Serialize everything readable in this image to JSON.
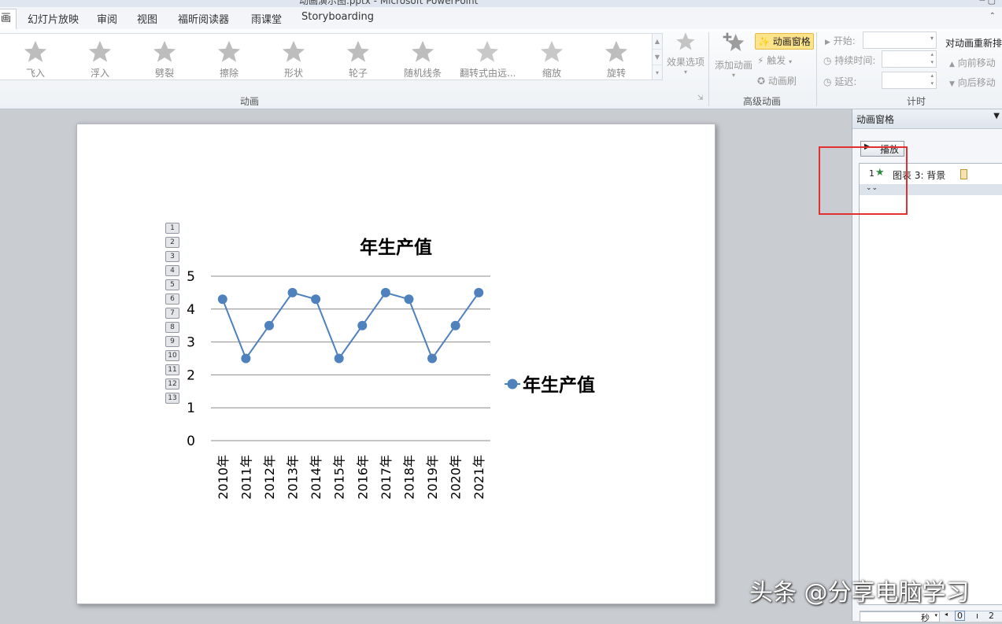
{
  "title_bar": {
    "title": "动画演示图.pptx - Microsoft PowerPoint"
  },
  "tabs": [
    {
      "label": "画"
    },
    {
      "label": "幻灯片放映"
    },
    {
      "label": "审阅"
    },
    {
      "label": "视图"
    },
    {
      "label": "福昕阅读器"
    },
    {
      "label": "雨课堂"
    },
    {
      "label": "Storyboarding"
    }
  ],
  "ribbon": {
    "animations": [
      {
        "label": "飞入",
        "icon": "star-fly-in-icon"
      },
      {
        "label": "浮入",
        "icon": "star-float-in-icon"
      },
      {
        "label": "劈裂",
        "icon": "star-split-icon"
      },
      {
        "label": "擦除",
        "icon": "star-wipe-icon"
      },
      {
        "label": "形状",
        "icon": "star-shape-icon"
      },
      {
        "label": "轮子",
        "icon": "star-wheel-icon"
      },
      {
        "label": "随机线条",
        "icon": "star-random-bars-icon"
      },
      {
        "label": "翻转式由远...",
        "icon": "star-grow-turn-icon"
      },
      {
        "label": "缩放",
        "icon": "star-zoom-icon"
      },
      {
        "label": "旋转",
        "icon": "star-swivel-icon"
      }
    ],
    "effect_options": "效果选项",
    "group_animation": "动画",
    "add_animation": "添加动画",
    "animation_pane_btn": "动画窗格",
    "trigger": "触发",
    "painter": "动画刷",
    "group_advanced": "高级动画",
    "start_label": "开始:",
    "duration_label": "持续时间:",
    "delay_label": "延迟:",
    "group_timing": "计时",
    "reorder_title": "对动画重新排",
    "move_earlier": "向前移动",
    "move_later": "向后移动"
  },
  "slide": {
    "sequence_tags": [
      "1",
      "2",
      "3",
      "4",
      "5",
      "6",
      "7",
      "8",
      "9",
      "10",
      "11",
      "12",
      "13"
    ]
  },
  "chart_data": {
    "type": "line",
    "title": "年生产值",
    "categories": [
      "2010年",
      "2011年",
      "2012年",
      "2013年",
      "2014年",
      "2015年",
      "2016年",
      "2017年",
      "2018年",
      "2019年",
      "2020年",
      "2021年"
    ],
    "series": [
      {
        "name": "年生产值",
        "values": [
          4.3,
          2.5,
          3.5,
          4.5,
          4.3,
          2.5,
          3.5,
          4.5,
          4.3,
          2.5,
          3.5,
          4.5
        ],
        "color": "#4f81bd"
      }
    ],
    "ylim": [
      0,
      5
    ],
    "yticks": [
      "0",
      "1",
      "2",
      "3",
      "4",
      "5"
    ],
    "grid": true,
    "legend": "right"
  },
  "pane": {
    "title": "动画窗格",
    "play": "播放",
    "item_number": "1",
    "item_label": "图表 3: 背景",
    "footer_unit": "秒",
    "footer_left": "0",
    "footer_right": "2"
  },
  "watermark": "头条 @分享电脑学习",
  "colors": {
    "accent": "#4f81bd",
    "highlight_box": "#e23030",
    "selected_button": "#fde38a"
  }
}
